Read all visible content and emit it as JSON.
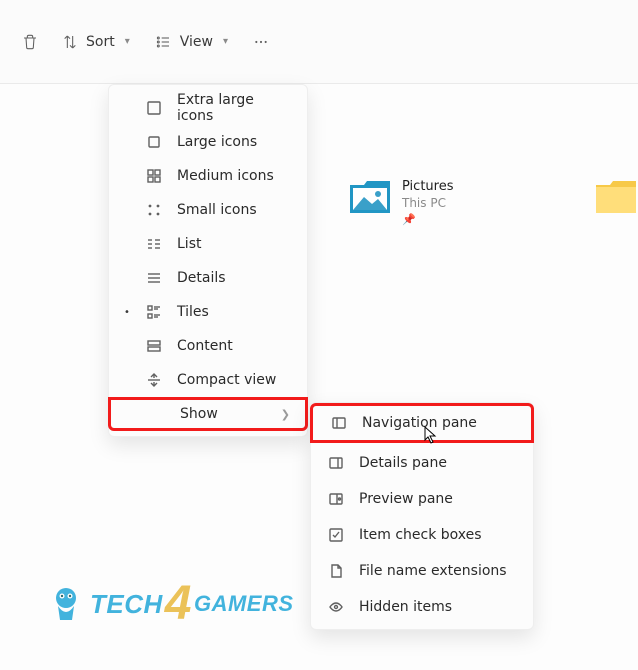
{
  "toolbar": {
    "sort_label": "Sort",
    "view_label": "View"
  },
  "folder": {
    "pictures": {
      "title": "Pictures",
      "subtitle": "This PC"
    }
  },
  "view_menu": {
    "items": [
      {
        "label": "Extra large icons"
      },
      {
        "label": "Large icons"
      },
      {
        "label": "Medium icons"
      },
      {
        "label": "Small icons"
      },
      {
        "label": "List"
      },
      {
        "label": "Details"
      },
      {
        "label": "Tiles"
      },
      {
        "label": "Content"
      },
      {
        "label": "Compact view"
      }
    ],
    "show_label": "Show"
  },
  "show_submenu": {
    "items": [
      {
        "label": "Navigation pane"
      },
      {
        "label": "Details pane"
      },
      {
        "label": "Preview pane"
      },
      {
        "label": "Item check boxes"
      },
      {
        "label": "File name extensions"
      },
      {
        "label": "Hidden items"
      }
    ]
  },
  "watermark": {
    "a": "TECH",
    "b": "4",
    "c": "GAMERS"
  }
}
